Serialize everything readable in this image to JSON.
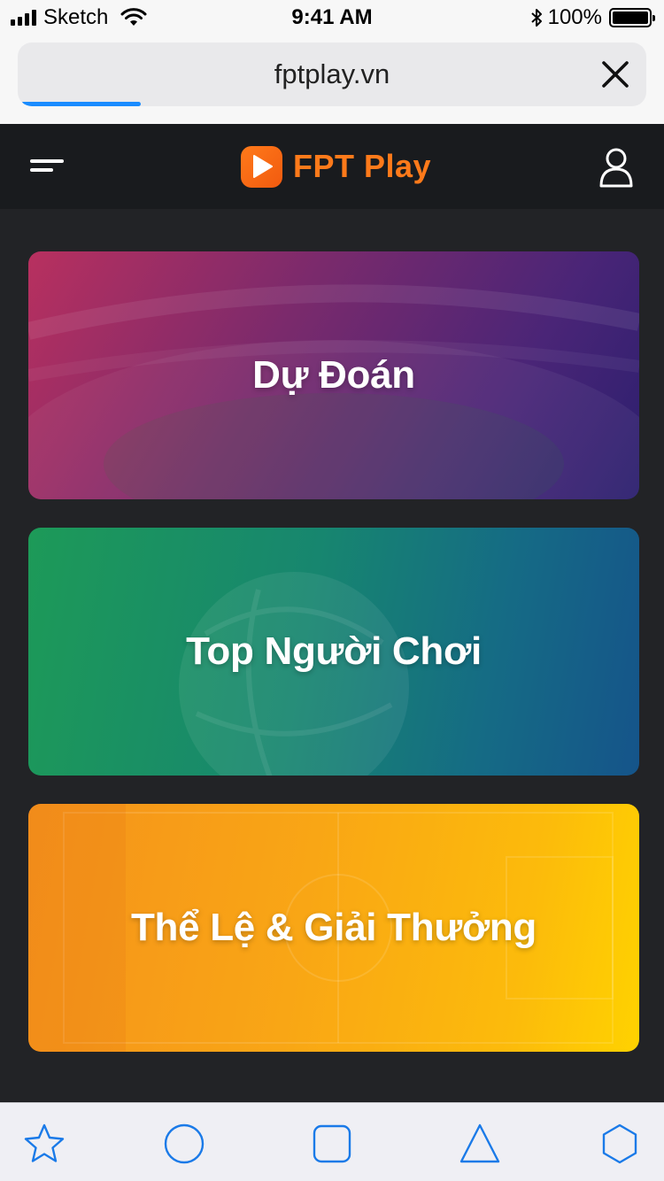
{
  "status_bar": {
    "carrier": "Sketch",
    "time": "9:41 AM",
    "battery_percent": "100%"
  },
  "browser": {
    "url": "fptplay.vn",
    "load_progress": 0.19
  },
  "header": {
    "logo_text": "FPT Play",
    "brand_color": "#ff7a1a"
  },
  "cards": [
    {
      "title": "Dự Đoán"
    },
    {
      "title": "Top Người Chơi"
    },
    {
      "title": "Thể Lệ & Giải Thưởng"
    }
  ],
  "toolbar": {
    "icons": [
      "star-icon",
      "circle-icon",
      "square-icon",
      "triangle-icon",
      "hexagon-icon"
    ],
    "accent_color": "#1a7ae8"
  }
}
